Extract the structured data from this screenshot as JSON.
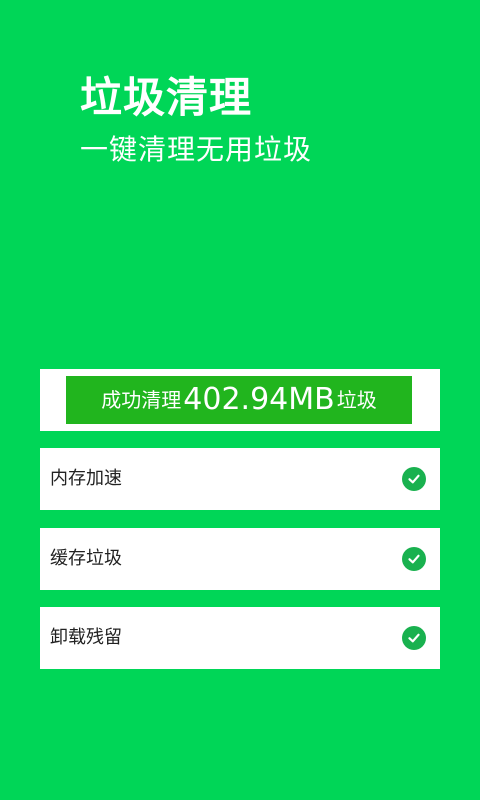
{
  "header": {
    "title": "垃圾清理",
    "subtitle": "一键清理无用垃圾"
  },
  "result": {
    "prefix": "成功清理",
    "amount": "402.94MB",
    "suffix": "垃圾"
  },
  "items": [
    {
      "label": "内存加速",
      "icon": "check-circle-icon",
      "status": "completed"
    },
    {
      "label": "缓存垃圾",
      "icon": "check-circle-icon",
      "status": "completed"
    },
    {
      "label": "卸载残留",
      "icon": "check-circle-icon",
      "status": "completed"
    }
  ],
  "colors": {
    "background": "#00d657",
    "banner": "#21b51e",
    "card": "#ffffff",
    "check": "#19b14f"
  }
}
